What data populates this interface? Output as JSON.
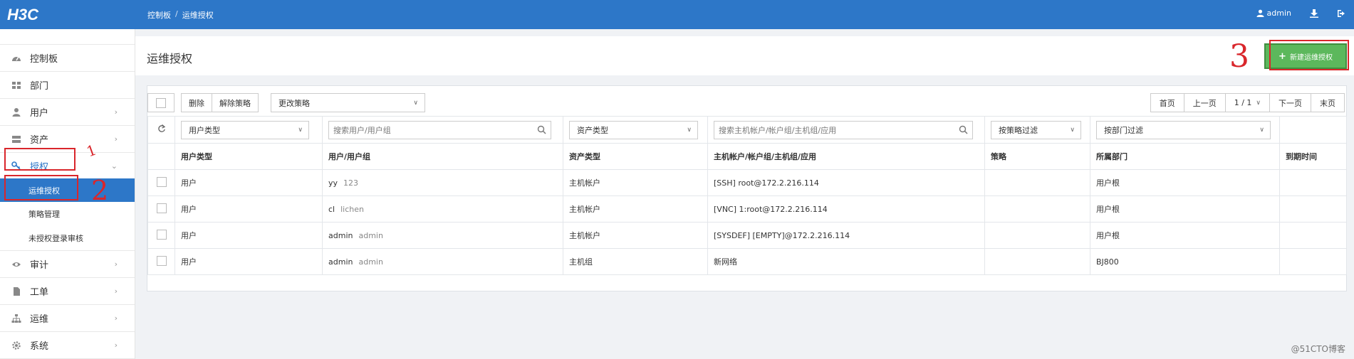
{
  "header": {
    "logo": "H3C",
    "breadcrumb": [
      "控制板",
      "运维授权"
    ],
    "user": "admin",
    "icons": [
      "user-icon",
      "download-icon",
      "logout-icon"
    ]
  },
  "sidebar": {
    "items": [
      {
        "label": "控制板",
        "icon": "dashboard-icon"
      },
      {
        "label": "部门",
        "icon": "grid-icon"
      },
      {
        "label": "用户",
        "icon": "user-icon"
      },
      {
        "label": "资产",
        "icon": "server-icon"
      },
      {
        "label": "授权",
        "icon": "key-icon"
      },
      {
        "label": "审计",
        "icon": "eye-icon"
      },
      {
        "label": "工单",
        "icon": "file-icon"
      },
      {
        "label": "运维",
        "icon": "sitemap-icon"
      },
      {
        "label": "系统",
        "icon": "gear-icon"
      }
    ],
    "sub_items": [
      "运维授权",
      "策略管理",
      "未授权登录审核"
    ]
  },
  "page": {
    "title": "运维授权",
    "new_button": "新建运维授权"
  },
  "toolbar": {
    "delete": "删除",
    "remove_policy": "解除策略",
    "change_policy": "更改策略",
    "pager": {
      "first": "首页",
      "prev": "上一页",
      "page": "1 / 1",
      "next": "下一页",
      "last": "末页"
    }
  },
  "filters": {
    "user_type": "用户类型",
    "user_search": "搜索用户/用户组",
    "asset_type": "资产类型",
    "account_search": "搜索主机帐户/帐户组/主机组/应用",
    "policy_filter": "按策略过滤",
    "dept_filter": "按部门过滤"
  },
  "table": {
    "columns": [
      "用户类型",
      "用户/用户组",
      "资产类型",
      "主机帐户/帐户组/主机组/应用",
      "策略",
      "所属部门",
      "到期时间"
    ],
    "rows": [
      {
        "user_type": "用户",
        "user": "yy",
        "user_sub": "123",
        "asset_type": "主机帐户",
        "account": "[SSH] root@172.2.216.114",
        "policy": "",
        "dept": "用户根",
        "expire": ""
      },
      {
        "user_type": "用户",
        "user": "cl",
        "user_sub": "lichen",
        "asset_type": "主机帐户",
        "account": "[VNC] 1:root@172.2.216.114",
        "policy": "",
        "dept": "用户根",
        "expire": ""
      },
      {
        "user_type": "用户",
        "user": "admin",
        "user_sub": "admin",
        "asset_type": "主机帐户",
        "account": "[SYSDEF] [EMPTY]@172.2.216.114",
        "policy": "",
        "dept": "用户根",
        "expire": ""
      },
      {
        "user_type": "用户",
        "user": "admin",
        "user_sub": "admin",
        "asset_type": "主机组",
        "account": "新网络",
        "policy": "",
        "dept": "BJ800",
        "expire": ""
      }
    ]
  },
  "annotations": [
    "1",
    "2",
    "3"
  ],
  "watermark": "@51CTO博客",
  "colors": {
    "topbar": "#2d77c8",
    "accent": "#2d77c8",
    "new_button": "#5cb85c",
    "annotation": "#d9262b"
  }
}
